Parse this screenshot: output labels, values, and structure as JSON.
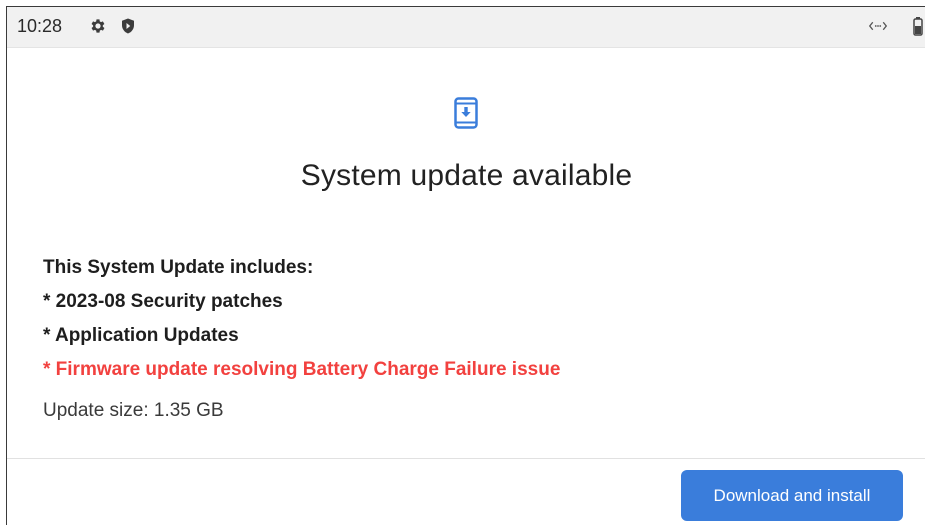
{
  "status_bar": {
    "time": "10:28",
    "icons": [
      "gear-icon",
      "shield-icon",
      "vibrate-icon",
      "battery-icon"
    ]
  },
  "update": {
    "icon": "system-update-phone-icon",
    "title": "System update available",
    "details": [
      {
        "text": "This System Update includes:",
        "color": "#1e1e1e"
      },
      {
        "text": "* 2023-08 Security patches",
        "color": "#1e1e1e"
      },
      {
        "text": "* Application Updates",
        "color": "#1e1e1e"
      },
      {
        "text": "* Firmware update resolving Battery Charge Failure issue",
        "color": "#f2413f"
      }
    ],
    "size_text": "Update size: 1.35 GB"
  },
  "actions": {
    "download_label": "Download and install"
  },
  "colors": {
    "accent": "#3a7ddb",
    "alert": "#f2413f"
  }
}
